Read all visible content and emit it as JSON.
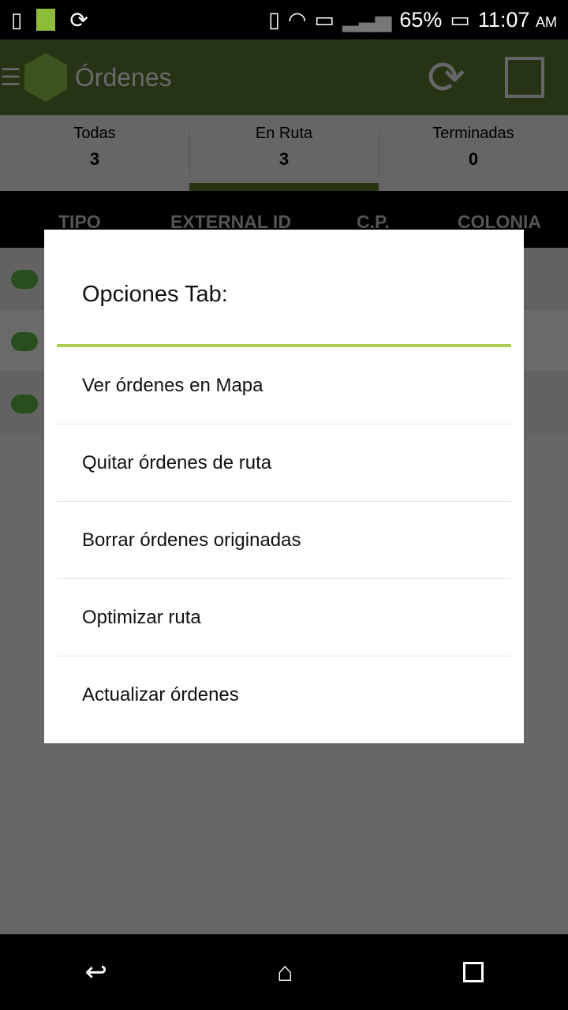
{
  "status": {
    "battery": "65%",
    "time": "11:07",
    "ampm": "AM"
  },
  "appbar": {
    "title": "Órdenes"
  },
  "tabs": [
    {
      "label": "Todas",
      "count": "3"
    },
    {
      "label": "En Ruta",
      "count": "3"
    },
    {
      "label": "Terminadas",
      "count": "0"
    }
  ],
  "columns": [
    "TIPO",
    "EXTERNAL ID",
    "C.P.",
    "COLONIA"
  ],
  "dialog": {
    "title": "Opciones Tab:",
    "accent": "#b0cc55",
    "items": [
      "Ver órdenes en Mapa",
      "Quitar órdenes de ruta",
      "Borrar órdenes originadas",
      "Optimizar ruta",
      "Actualizar órdenes"
    ]
  }
}
